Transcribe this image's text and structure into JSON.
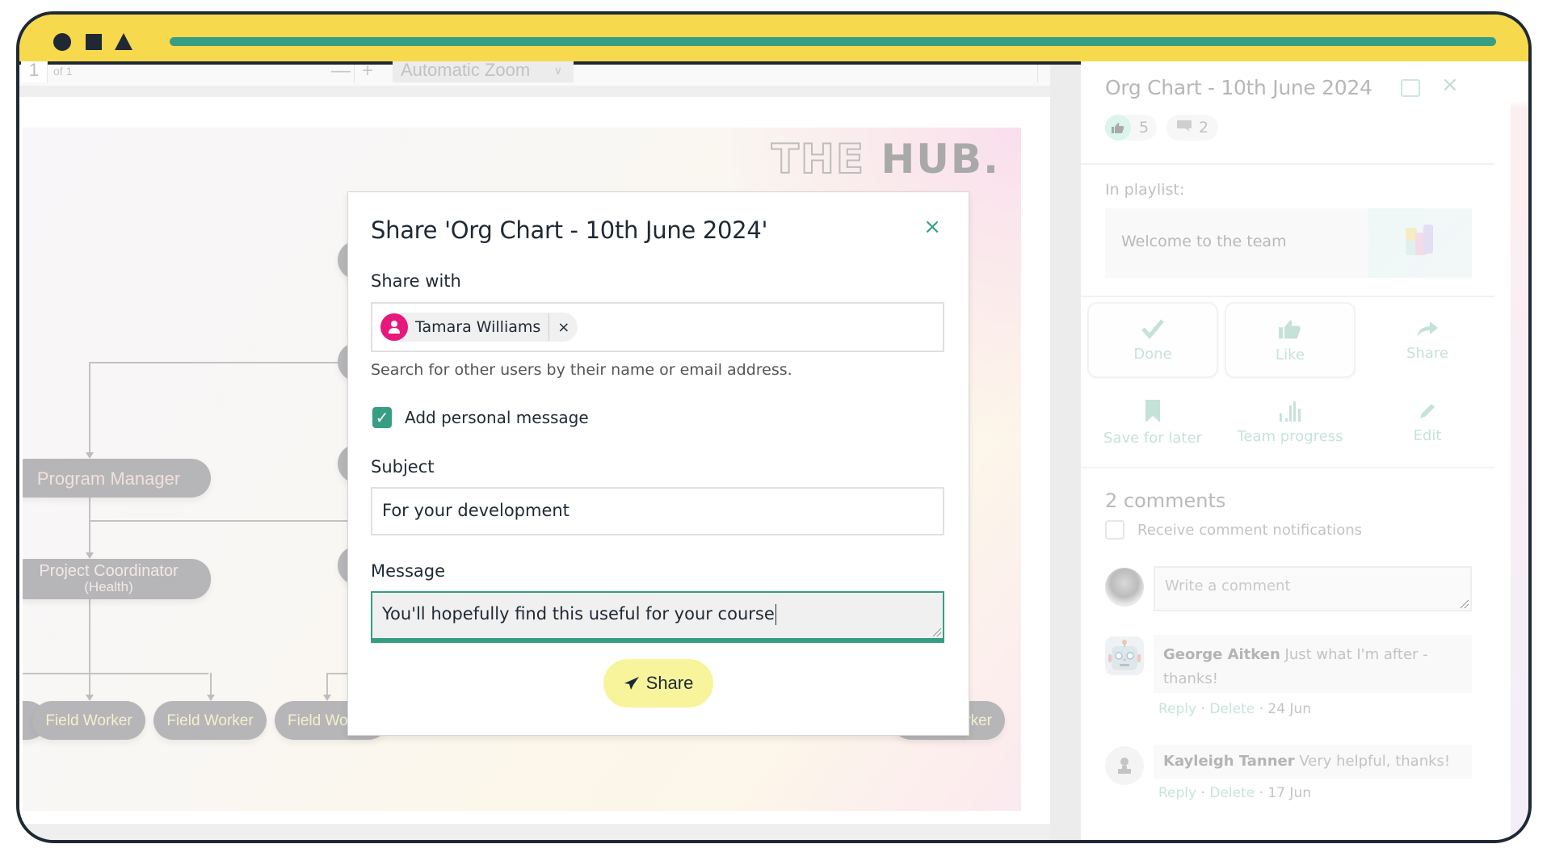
{
  "window": {
    "controls": [
      "circle",
      "square",
      "triangle"
    ],
    "progress_percent": 100,
    "accent_color": "#379e84",
    "titlebar_color": "#f7d94e"
  },
  "pdf_toolbar": {
    "page_number": "1",
    "page_count": "of 1",
    "zoom_out": "—",
    "zoom_in": "+",
    "zoom_level": "Automatic Zoom",
    "more": "»"
  },
  "slide": {
    "logo_outline": "THE",
    "logo_bold": "HUB.",
    "nodes": {
      "program_manager": "Program Manager",
      "project_coordinator": "Project Coordinator",
      "project_coordinator_sub": "(Health)",
      "field_workers": [
        "Field Worker",
        "Field Worker",
        "Field Worker",
        "Field Worker"
      ]
    }
  },
  "dialog": {
    "title": "Share 'Org Chart - 10th June 2024'",
    "close": "×",
    "share_with_label": "Share with",
    "recipients": [
      {
        "name": "Tamara Williams",
        "remove": "×",
        "avatar_color": "#e8177d"
      }
    ],
    "search_help": "Search for other users by their name or email address.",
    "add_message_label": "Add personal message",
    "add_message_checked": true,
    "subject_label": "Subject",
    "subject_value": "For your development",
    "message_label": "Message",
    "message_value": "You'll hopefully find this useful for your course",
    "share_button": "Share",
    "share_button_color": "#f7f49c"
  },
  "panel": {
    "title": "Org Chart - 10th June 2024",
    "close": "×",
    "likes": "5",
    "comment_count": "2",
    "in_playlist_label": "In playlist:",
    "playlist_title": "Welcome to the team",
    "actions": [
      {
        "label": "Done",
        "icon": "check-icon"
      },
      {
        "label": "Like",
        "icon": "thumbs-up-icon"
      },
      {
        "label": "Share",
        "icon": "share-arrow-icon"
      },
      {
        "label": "Save for later",
        "icon": "bookmark-icon"
      },
      {
        "label": "Team progress",
        "icon": "bar-chart-icon"
      },
      {
        "label": "Edit",
        "icon": "pencil-icon"
      }
    ],
    "comments_heading": "2 comments",
    "notify_label": "Receive comment notifications",
    "notify_checked": false,
    "comment_placeholder": "Write a comment",
    "comments": [
      {
        "author": "George Aitken",
        "text": "Just what I'm after - thanks!",
        "reply": "Reply",
        "delete": "Delete",
        "date": "24 Jun",
        "avatar": "robot"
      },
      {
        "author": "Kayleigh Tanner",
        "text": "Very helpful, thanks!",
        "reply": "Reply",
        "delete": "Delete",
        "date": "17 Jun",
        "avatar": "default-user"
      }
    ]
  }
}
